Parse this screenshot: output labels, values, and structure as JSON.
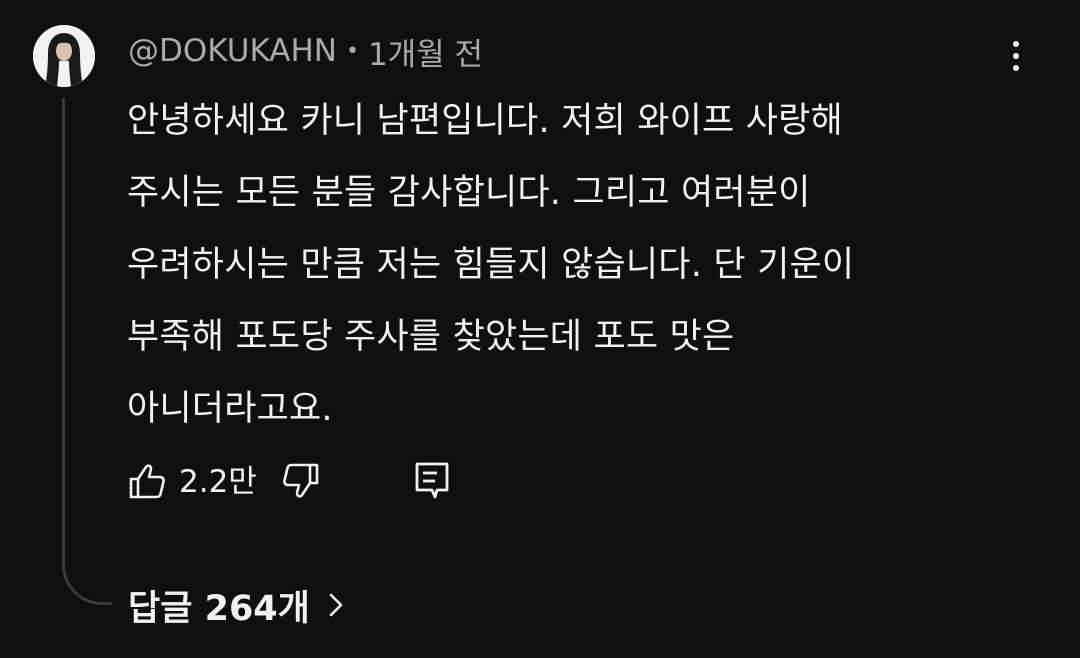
{
  "comment": {
    "author": "@DOKUKAHN",
    "separator": "•",
    "time": "1개월 전",
    "text_lines": [
      "안녕하세요 카니 남편입니다. 저희 와이프 사랑해",
      "주시는 모든 분들 감사합니다. 그리고 여러분이",
      "우려하시는 만큼 저는 힘들지 않습니다. 단 기운이",
      "부족해 포도당 주사를 찾았는데 포도 맛은",
      "아니더라고요."
    ],
    "like_count": "2.2만",
    "replies_label": "답글 264개"
  },
  "icons": {
    "avatar": "avatar",
    "more": "more-vert-icon",
    "like": "thumb-up-icon",
    "dislike": "thumb-down-icon",
    "reply": "comment-reply-icon",
    "chevron": "chevron-right-icon"
  },
  "colors": {
    "background": "#0f0f0f",
    "text_primary": "#f1f1f1",
    "text_secondary": "#aaaaaa",
    "thread_line": "#3a3a3a"
  }
}
